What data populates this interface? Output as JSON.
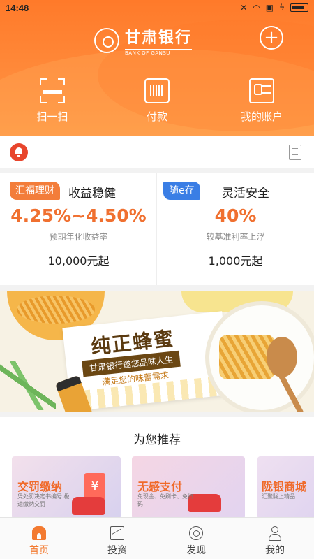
{
  "status_bar": {
    "time": "14:48"
  },
  "header": {
    "bank_name_cn": "甘肃银行",
    "bank_name_en": "BANK OF GANSU",
    "quick_actions": [
      {
        "label": "扫一扫",
        "icon": "scan-icon"
      },
      {
        "label": "付款",
        "icon": "payment-barcode-icon"
      },
      {
        "label": "我的账户",
        "icon": "account-card-icon"
      }
    ]
  },
  "products": [
    {
      "tag": "汇福理财",
      "title": "收益稳健",
      "rate": "4.25%~4.50%",
      "rate_desc": "预期年化收益率",
      "min": "10,000元起",
      "tag_color": "#f37d3a"
    },
    {
      "tag": "随e存",
      "title": "灵活安全",
      "rate": "40%",
      "rate_desc": "较基准利率上浮",
      "min": "1,000元起",
      "tag_color": "#3a7ee5"
    }
  ],
  "banner": {
    "title": "纯正蜂蜜",
    "ribbon": "甘肃银行邀您品味人生",
    "subtitle": "满足您的味蕾需求"
  },
  "recommend": {
    "title": "为您推荐",
    "cards": [
      {
        "title": "交罚缴纳",
        "sub": "凭处罚决定书编号 极速缴纳交罚"
      },
      {
        "title": "无感支付",
        "sub": "免现金、免刷卡、免扫码"
      },
      {
        "title": "陇银商城",
        "sub": "汇聚陇上精品"
      }
    ]
  },
  "tabbar": {
    "tabs": [
      {
        "label": "首页",
        "icon": "home-icon",
        "active": true
      },
      {
        "label": "投资",
        "icon": "invest-chart-icon",
        "active": false
      },
      {
        "label": "发现",
        "icon": "discover-icon",
        "active": false
      },
      {
        "label": "我的",
        "icon": "profile-icon",
        "active": false
      }
    ]
  },
  "colors": {
    "brand_orange": "#ff7a2a",
    "accent_orange": "#f37a30",
    "tag_blue": "#3a7ee5"
  }
}
